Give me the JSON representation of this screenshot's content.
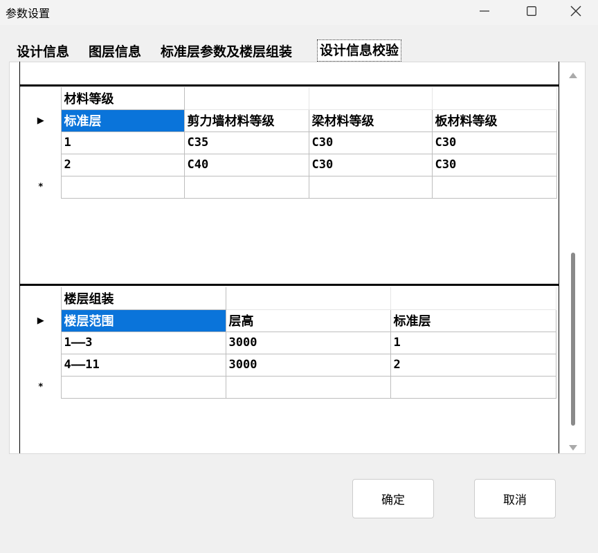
{
  "window": {
    "title": "参数设置"
  },
  "tabs": [
    {
      "label": "设计信息"
    },
    {
      "label": "图层信息"
    },
    {
      "label": "标准层参数及楼层组装"
    },
    {
      "label": "设计信息校验",
      "active": true
    }
  ],
  "material_grid": {
    "caption": "材料等级",
    "columns": [
      "标准层",
      "剪力墙材料等级",
      "梁材料等级",
      "板材料等级"
    ],
    "rows": [
      [
        "1",
        "C35",
        "C30",
        "C30"
      ],
      [
        "2",
        "C40",
        "C30",
        "C30"
      ]
    ],
    "current_row_marker": "▶",
    "new_row_marker": "*"
  },
  "floor_grid": {
    "caption": "楼层组装",
    "columns": [
      "楼层范围",
      "层高",
      "标准层"
    ],
    "rows": [
      [
        "1——3",
        "3000",
        "1"
      ],
      [
        "4——11",
        "3000",
        "2"
      ]
    ],
    "current_row_marker": "▶",
    "new_row_marker": "*"
  },
  "buttons": {
    "ok": "确定",
    "cancel": "取消"
  },
  "colors": {
    "selected_cell": "#0a74da",
    "window_bg": "#f0f0f0"
  },
  "icons": {
    "minimize": "minimize-icon",
    "maximize": "maximize-icon",
    "close": "close-icon"
  }
}
